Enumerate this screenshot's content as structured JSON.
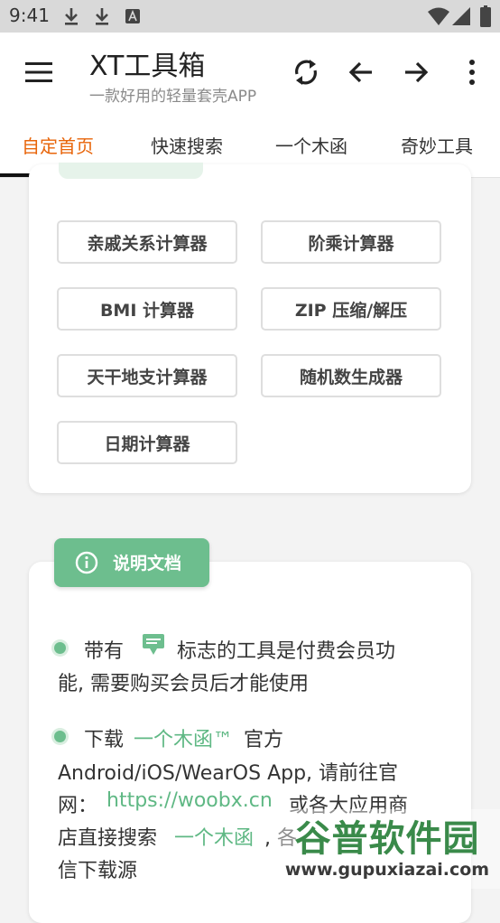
{
  "status_bar": {
    "time": "9:41"
  },
  "app_bar": {
    "title": "XT工具箱",
    "subtitle": "一款好用的轻量套壳APP"
  },
  "tabs": [
    {
      "label": "自定首页",
      "active": true
    },
    {
      "label": "快速搜索",
      "active": false
    },
    {
      "label": "一个木函",
      "active": false
    },
    {
      "label": "奇妙工具",
      "active": false
    }
  ],
  "tools": [
    "亲戚关系计算器",
    "阶乘计算器",
    "BMI 计算器",
    "ZIP 压缩/解压",
    "天干地支计算器",
    "随机数生成器",
    "日期计算器"
  ],
  "doc": {
    "badge": "说明文档",
    "p1": {
      "a": "带有",
      "b": "标志的工具是付费会员功",
      "c": "能, 需要购买会员后才能使用"
    },
    "p2": {
      "a": "下载",
      "brand": "一个木函™",
      "b": "官方",
      "c": "Android/iOS/WearOS App, 请前往官",
      "d": "网：",
      "url": "https://woobx.cn",
      "e": "或各大应用商",
      "f": "店直接搜索",
      "brand2": "一个木函",
      "g": ", 各",
      "h": "信下载源"
    }
  },
  "watermark": {
    "title": "谷普软件园",
    "url": "www.gupuxiazai.com"
  },
  "colors": {
    "accent": "#e8650a",
    "green": "#6dbe8e",
    "link": "#5fb884"
  }
}
